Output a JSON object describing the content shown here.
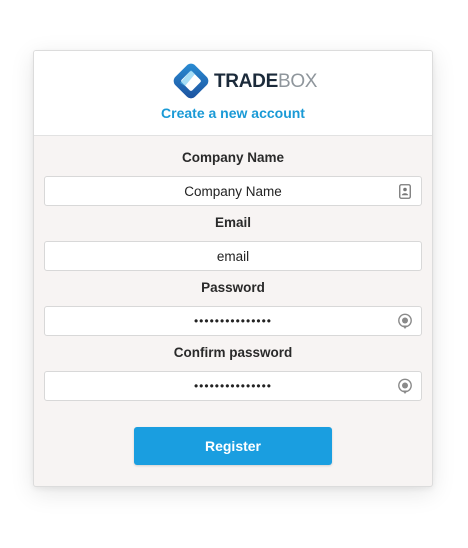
{
  "brand": {
    "logo_strong": "TRADE",
    "logo_light": "BOX",
    "subtitle": "Create a new account",
    "accent_color": "#1a9ad6"
  },
  "form": {
    "company": {
      "label": "Company Name",
      "placeholder": "Company Name",
      "value": "",
      "icon": "contact-card-icon"
    },
    "email": {
      "label": "Email",
      "placeholder": "email",
      "value": ""
    },
    "password": {
      "label": "Password",
      "value": "•••••••••••••••",
      "icon": "password-reveal-icon"
    },
    "confirm_password": {
      "label": "Confirm password",
      "value": "•••••••••••••••",
      "icon": "password-reveal-icon"
    },
    "submit_label": "Register",
    "submit_color": "#1a9ee0"
  }
}
